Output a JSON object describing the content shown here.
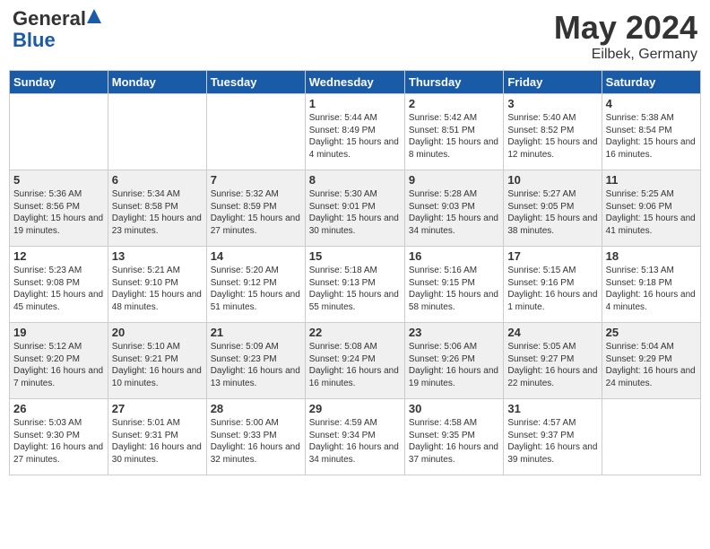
{
  "logo": {
    "general": "General",
    "blue": "Blue"
  },
  "title": "May 2024",
  "subtitle": "Eilbek, Germany",
  "days_of_week": [
    "Sunday",
    "Monday",
    "Tuesday",
    "Wednesday",
    "Thursday",
    "Friday",
    "Saturday"
  ],
  "weeks": [
    [
      {
        "num": "",
        "info": ""
      },
      {
        "num": "",
        "info": ""
      },
      {
        "num": "",
        "info": ""
      },
      {
        "num": "1",
        "info": "Sunrise: 5:44 AM\nSunset: 8:49 PM\nDaylight: 15 hours and 4 minutes."
      },
      {
        "num": "2",
        "info": "Sunrise: 5:42 AM\nSunset: 8:51 PM\nDaylight: 15 hours and 8 minutes."
      },
      {
        "num": "3",
        "info": "Sunrise: 5:40 AM\nSunset: 8:52 PM\nDaylight: 15 hours and 12 minutes."
      },
      {
        "num": "4",
        "info": "Sunrise: 5:38 AM\nSunset: 8:54 PM\nDaylight: 15 hours and 16 minutes."
      }
    ],
    [
      {
        "num": "5",
        "info": "Sunrise: 5:36 AM\nSunset: 8:56 PM\nDaylight: 15 hours and 19 minutes."
      },
      {
        "num": "6",
        "info": "Sunrise: 5:34 AM\nSunset: 8:58 PM\nDaylight: 15 hours and 23 minutes."
      },
      {
        "num": "7",
        "info": "Sunrise: 5:32 AM\nSunset: 8:59 PM\nDaylight: 15 hours and 27 minutes."
      },
      {
        "num": "8",
        "info": "Sunrise: 5:30 AM\nSunset: 9:01 PM\nDaylight: 15 hours and 30 minutes."
      },
      {
        "num": "9",
        "info": "Sunrise: 5:28 AM\nSunset: 9:03 PM\nDaylight: 15 hours and 34 minutes."
      },
      {
        "num": "10",
        "info": "Sunrise: 5:27 AM\nSunset: 9:05 PM\nDaylight: 15 hours and 38 minutes."
      },
      {
        "num": "11",
        "info": "Sunrise: 5:25 AM\nSunset: 9:06 PM\nDaylight: 15 hours and 41 minutes."
      }
    ],
    [
      {
        "num": "12",
        "info": "Sunrise: 5:23 AM\nSunset: 9:08 PM\nDaylight: 15 hours and 45 minutes."
      },
      {
        "num": "13",
        "info": "Sunrise: 5:21 AM\nSunset: 9:10 PM\nDaylight: 15 hours and 48 minutes."
      },
      {
        "num": "14",
        "info": "Sunrise: 5:20 AM\nSunset: 9:12 PM\nDaylight: 15 hours and 51 minutes."
      },
      {
        "num": "15",
        "info": "Sunrise: 5:18 AM\nSunset: 9:13 PM\nDaylight: 15 hours and 55 minutes."
      },
      {
        "num": "16",
        "info": "Sunrise: 5:16 AM\nSunset: 9:15 PM\nDaylight: 15 hours and 58 minutes."
      },
      {
        "num": "17",
        "info": "Sunrise: 5:15 AM\nSunset: 9:16 PM\nDaylight: 16 hours and 1 minute."
      },
      {
        "num": "18",
        "info": "Sunrise: 5:13 AM\nSunset: 9:18 PM\nDaylight: 16 hours and 4 minutes."
      }
    ],
    [
      {
        "num": "19",
        "info": "Sunrise: 5:12 AM\nSunset: 9:20 PM\nDaylight: 16 hours and 7 minutes."
      },
      {
        "num": "20",
        "info": "Sunrise: 5:10 AM\nSunset: 9:21 PM\nDaylight: 16 hours and 10 minutes."
      },
      {
        "num": "21",
        "info": "Sunrise: 5:09 AM\nSunset: 9:23 PM\nDaylight: 16 hours and 13 minutes."
      },
      {
        "num": "22",
        "info": "Sunrise: 5:08 AM\nSunset: 9:24 PM\nDaylight: 16 hours and 16 minutes."
      },
      {
        "num": "23",
        "info": "Sunrise: 5:06 AM\nSunset: 9:26 PM\nDaylight: 16 hours and 19 minutes."
      },
      {
        "num": "24",
        "info": "Sunrise: 5:05 AM\nSunset: 9:27 PM\nDaylight: 16 hours and 22 minutes."
      },
      {
        "num": "25",
        "info": "Sunrise: 5:04 AM\nSunset: 9:29 PM\nDaylight: 16 hours and 24 minutes."
      }
    ],
    [
      {
        "num": "26",
        "info": "Sunrise: 5:03 AM\nSunset: 9:30 PM\nDaylight: 16 hours and 27 minutes."
      },
      {
        "num": "27",
        "info": "Sunrise: 5:01 AM\nSunset: 9:31 PM\nDaylight: 16 hours and 30 minutes."
      },
      {
        "num": "28",
        "info": "Sunrise: 5:00 AM\nSunset: 9:33 PM\nDaylight: 16 hours and 32 minutes."
      },
      {
        "num": "29",
        "info": "Sunrise: 4:59 AM\nSunset: 9:34 PM\nDaylight: 16 hours and 34 minutes."
      },
      {
        "num": "30",
        "info": "Sunrise: 4:58 AM\nSunset: 9:35 PM\nDaylight: 16 hours and 37 minutes."
      },
      {
        "num": "31",
        "info": "Sunrise: 4:57 AM\nSunset: 9:37 PM\nDaylight: 16 hours and 39 minutes."
      },
      {
        "num": "",
        "info": ""
      }
    ]
  ]
}
